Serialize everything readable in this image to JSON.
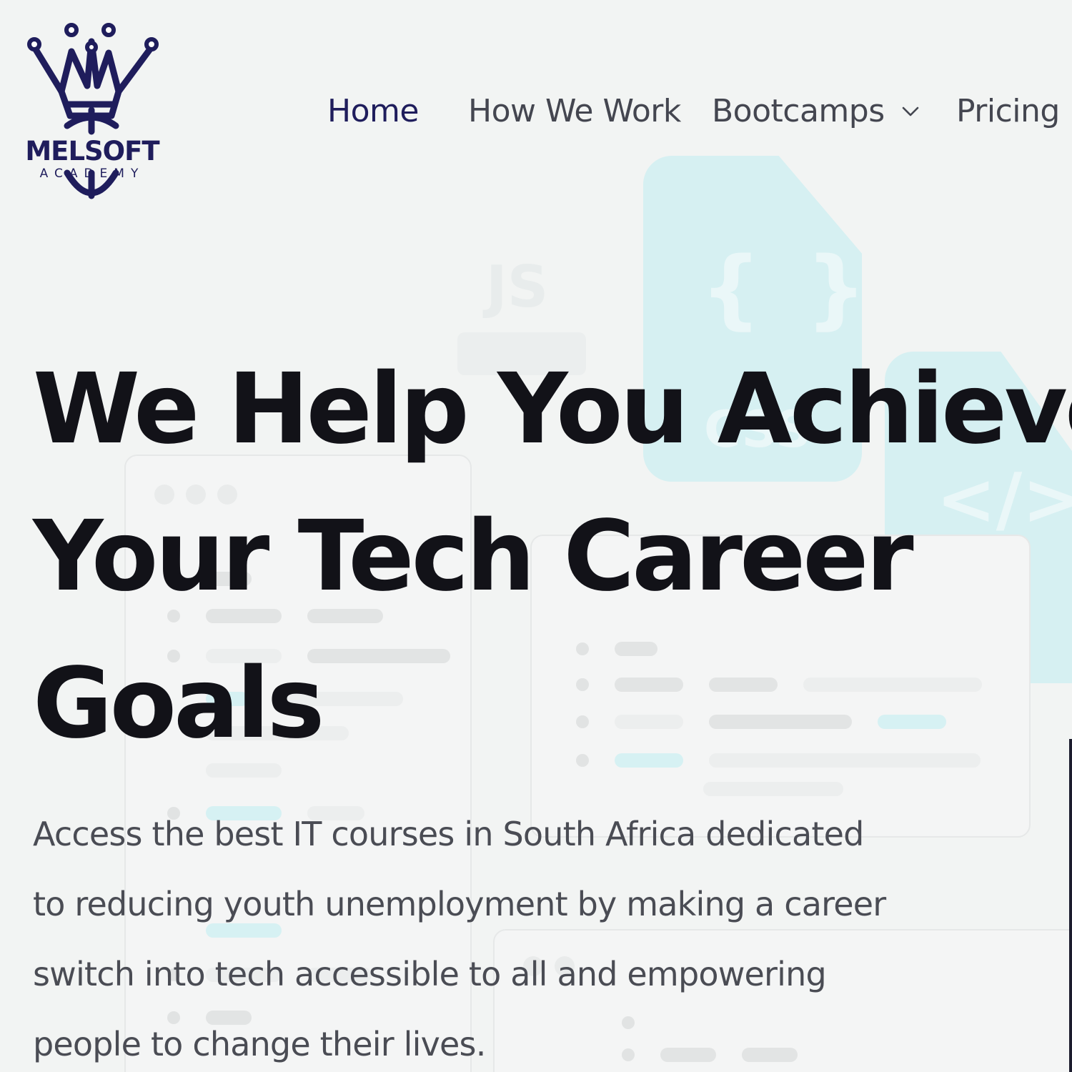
{
  "brand": {
    "name": "MELSOFT",
    "tagline": "ACADEMY",
    "color": "#1f1d5c"
  },
  "nav": {
    "items": [
      {
        "label": "Home",
        "active": true
      },
      {
        "label": "How We Work",
        "active": false
      },
      {
        "label": "Bootcamps",
        "active": false,
        "has_dropdown": true
      },
      {
        "label": "Pricing",
        "active": false
      }
    ]
  },
  "hero": {
    "title_lines": [
      "We Help You Achieve",
      "Your Tech Career",
      "Goals"
    ],
    "description_lines": [
      "Access the best IT courses in South Africa dedicated",
      "to reducing youth unemployment by making a career",
      "switch into tech accessible to all and empowering",
      "people to change their lives."
    ]
  },
  "colors": {
    "background": "#f2f4f3",
    "accent_teal": "#d6f0f2",
    "heading": "#121218",
    "body_text": "#4a4c54"
  },
  "icons": [
    "crown-logo-icon",
    "chevron-down-icon"
  ]
}
